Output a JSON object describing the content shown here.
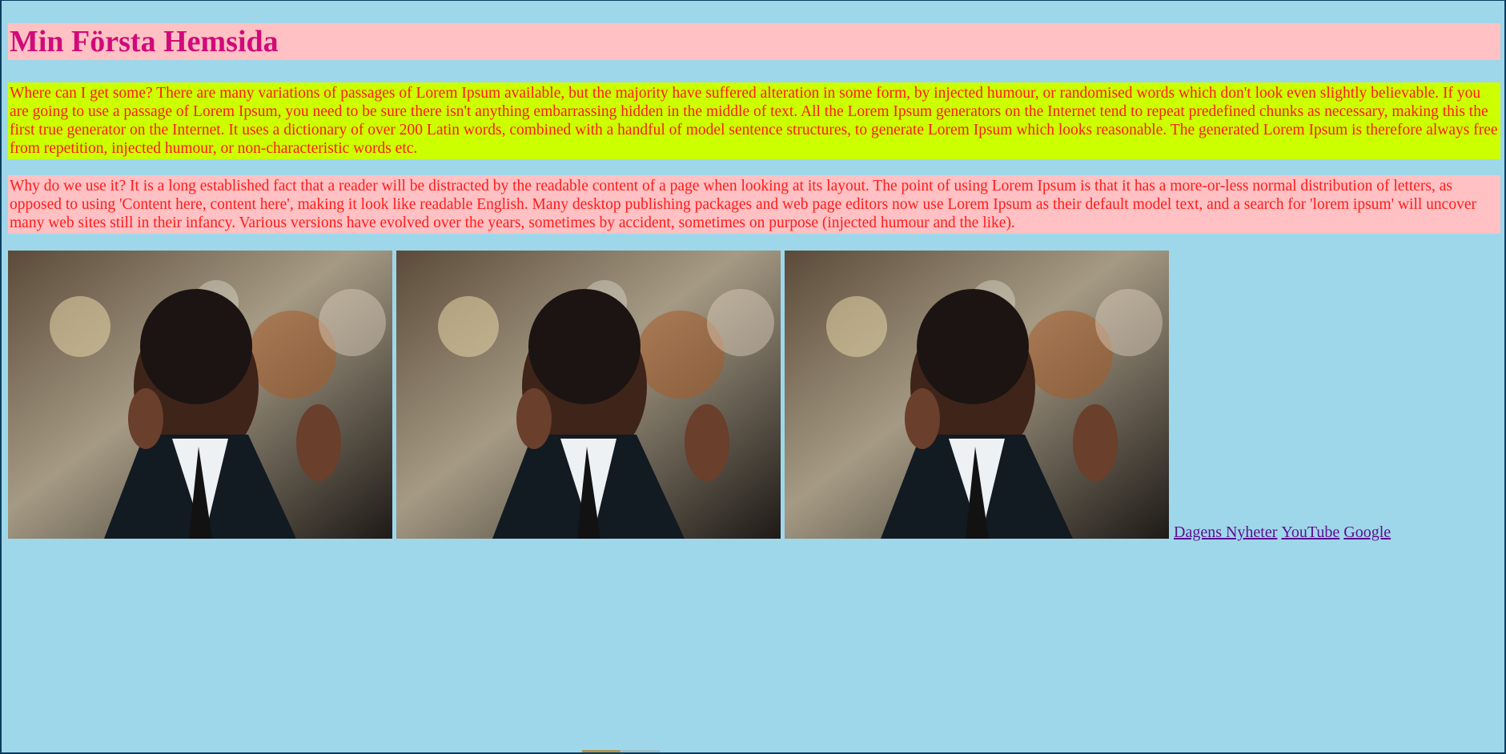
{
  "page": {
    "title": "Min Första Hemsida",
    "paragraphs": [
      "Where can I get some? There are many variations of passages of Lorem Ipsum available, but the majority have suffered alteration in some form, by injected humour, or randomised words which don't look even slightly believable. If you are going to use a passage of Lorem Ipsum, you need to be sure there isn't anything embarrassing hidden in the middle of text. All the Lorem Ipsum generators on the Internet tend to repeat predefined chunks as necessary, making this the first true generator on the Internet. It uses a dictionary of over 200 Latin words, combined with a handful of model sentence structures, to generate Lorem Ipsum which looks reasonable. The generated Lorem Ipsum is therefore always free from repetition, injected humour, or non-characteristic words etc.",
      "Why do we use it? It is a long established fact that a reader will be distracted by the readable content of a page when looking at its layout. The point of using Lorem Ipsum is that it has a more-or-less normal distribution of letters, as opposed to using 'Content here, content here', making it look like readable English. Many desktop publishing packages and web page editors now use Lorem Ipsum as their default model text, and a search for 'lorem ipsum' will uncover many web sites still in their infancy. Various versions have evolved over the years, sometimes by accident, sometimes on purpose (injected humour and the like)."
    ],
    "images_count_note": "",
    "links": [
      "Dagens Nyheter",
      "YouTube",
      "Google"
    ]
  },
  "colors": {
    "background": "#9fd7ea",
    "title_bg": "#ffc1c3",
    "title_text": "#d10a7a",
    "paragraph_1_bg": "#ccff00",
    "paragraph_2_bg": "#ffc1c3",
    "paragraph_text": "#ff1b1b",
    "link": "#5a0f91"
  }
}
